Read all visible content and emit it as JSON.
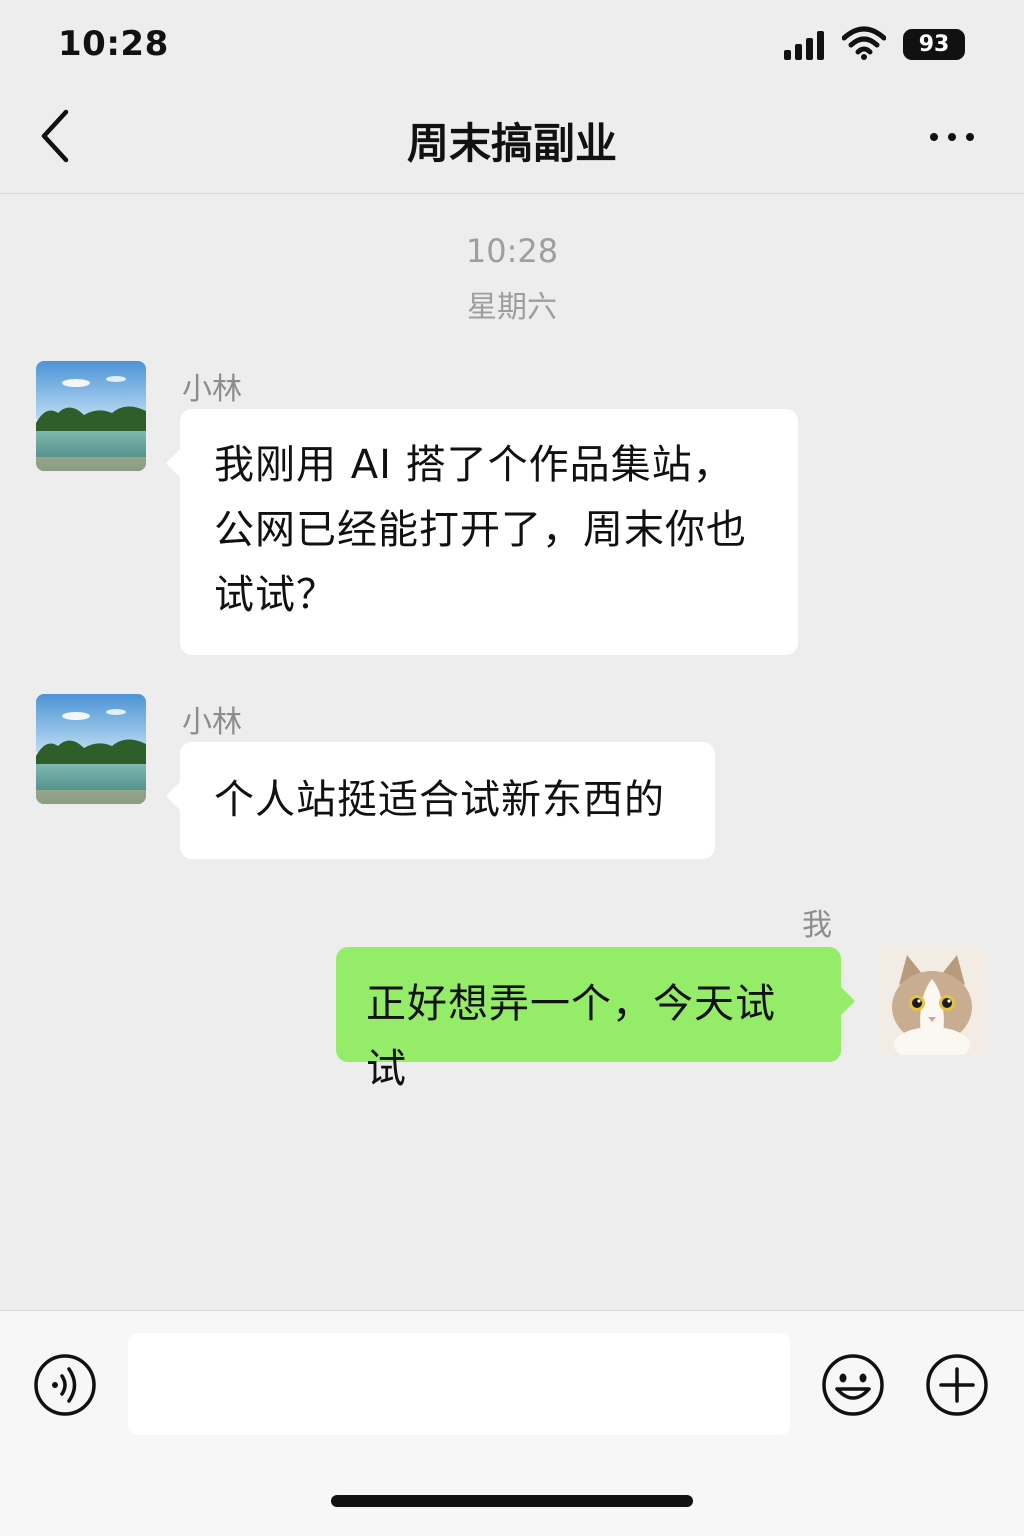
{
  "status_bar": {
    "time": "10:28",
    "battery": "93",
    "icons": [
      "signal-icon",
      "wifi-icon",
      "battery-icon"
    ]
  },
  "nav": {
    "title": "周末搞副业",
    "back_icon": "chevron-left-icon",
    "more_icon": "more-dots-icon"
  },
  "timestamp": {
    "time": "10:28",
    "day": "星期六"
  },
  "messages": [
    {
      "sender": "小林",
      "direction": "incoming",
      "lines": [
        "我刚用 AI 搭了个作品集站，",
        "公网已经能打开了，周末你也",
        "试试？"
      ]
    },
    {
      "sender": "小林",
      "direction": "incoming",
      "lines": [
        "个人站挺适合试新东西的"
      ]
    },
    {
      "sender": "我",
      "direction": "outgoing",
      "lines": [
        "正好想弄一个，今天试试"
      ]
    }
  ],
  "input_bar": {
    "voice_icon": "voice-icon",
    "emoji_icon": "emoji-icon",
    "plus_icon": "plus-icon",
    "text_value": ""
  },
  "colors": {
    "background": "#ededed",
    "incoming_bubble": "#ffffff",
    "outgoing_bubble": "#95ec69",
    "secondary_text": "#8d8d8d"
  }
}
